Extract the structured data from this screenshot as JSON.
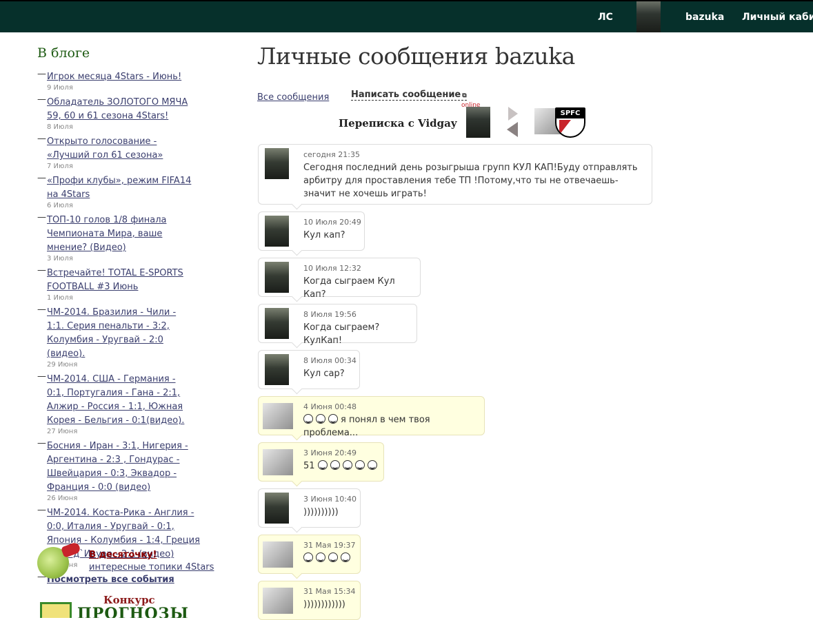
{
  "nav": {
    "ls": "ЛС",
    "username": "bazuka",
    "cabinet": "Личный кабин"
  },
  "sidebar": {
    "title": "В блоге",
    "items": [
      {
        "title": "Игрок месяца 4Stars - Июнь!",
        "date": "9 Июля"
      },
      {
        "title": "Обладатель ЗОЛОТОГО МЯЧА 59, 60 и 61 сезона 4Stars!",
        "date": "8 Июля"
      },
      {
        "title": "Открыто голосование - «Лучший гол 61 сезона»",
        "date": "7 Июля"
      },
      {
        "title": "«Профи клубы», режим FIFA14 на 4Stars",
        "date": "6 Июля"
      },
      {
        "title": "ТОП-10 голов 1/8 финала Чемпионата Мира, ваше мнение? (Видео)",
        "date": "3 Июля"
      },
      {
        "title": "Встречайте! TOTAL E-SPORTS FOOTBALL #3 Июнь",
        "date": "1 Июля"
      },
      {
        "title": "ЧМ-2014. Бразилия - Чили - 1:1. Серия пенальти - 3:2, Колумбия - Уругвай - 2:0 (видео).",
        "date": "29 Июня"
      },
      {
        "title": "ЧМ-2014. США - Германия - 0:1, Португалия - Гана - 2:1, Алжир - Россия - 1:1, Южная Корея - Бельгия - 0:1(видео).",
        "date": "27 Июня"
      },
      {
        "title": "Босния - Иран - 3:1, Нигерия - Аргентина - 2:3 , Гондурас - Швейцария - 0:3, Эквадор - Франция - 0:0 (видео)",
        "date": "26 Июня"
      },
      {
        "title": "ЧМ-2014. Коста-Рика - Англия - 0:0, Италия - Уругвай - 0:1, Япония - Колумбия - 1:4, Греция - Кот-д`Ивуар - 2:1 (видео)",
        "date": "25 Июня"
      }
    ],
    "see_all": "Посмотреть все события",
    "promo_title": "В десяточку!",
    "promo_sub": "интересные топики 4Stars",
    "contest_title": "Конкурс",
    "contest_big": "ПРОГНОЗЫ"
  },
  "main": {
    "title": "Личные сообщения bazuka",
    "tab_all": "Все сообщения",
    "tab_write": "Написать сообщение",
    "convo_title": "Переписка с Vidgay",
    "online": "online",
    "spfc": "SPFC"
  },
  "messages": [
    {
      "time": "сегодня 21:35",
      "text": "Сегодня последний день розыгрыша групп КУЛ КАП!Буду отправлять арбитру для проставления тебе ТП !Потому,что ты не отвечаешь- значит не хочешь играть!",
      "own": false
    },
    {
      "time": "10 Июля 20:49",
      "text": "Кул кап?",
      "own": false
    },
    {
      "time": "10 Июля 12:32",
      "text": "Когда сыграем Кул Кап?",
      "own": false
    },
    {
      "time": "8 Июля 19:56",
      "text": "Когда сыграем?КулКап!",
      "own": false
    },
    {
      "time": "8 Июля 00:34",
      "text": "Кул сар?",
      "own": false
    },
    {
      "time": "4 Июня 00:48",
      "text": "я понял в чем твоя проблема...",
      "own": true,
      "smileys": 3
    },
    {
      "time": "3 Июня 20:49",
      "text": "51",
      "own": true,
      "smileys": 5
    },
    {
      "time": "3 Июня 10:40",
      "text": "))))))))))",
      "own": false
    },
    {
      "time": "31 Мая 19:37",
      "text": "",
      "own": true,
      "smileys": 4
    },
    {
      "time": "31 Мая 15:34",
      "text": "))))))))))))",
      "own": true
    }
  ]
}
